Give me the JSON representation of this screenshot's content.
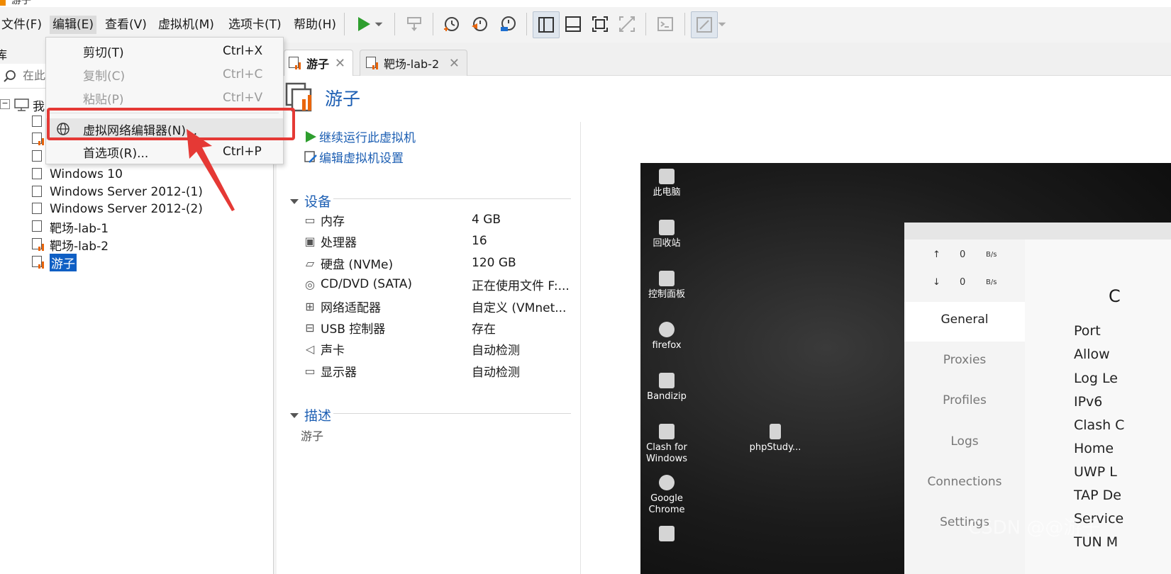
{
  "window": {
    "title": "游子"
  },
  "menubar": {
    "items": [
      "文件(F)",
      "编辑(E)",
      "查看(V)",
      "虚拟机(M)",
      "选项卡(T)",
      "帮助(H)"
    ]
  },
  "toolbar": {
    "icons": [
      "play-icon",
      "dropdown-arrow-icon",
      "send-keys-icon",
      "snapshot-icon",
      "revert-snapshot-icon",
      "snapshot-manager-icon",
      "sidebar-view-icon",
      "thumbnail-view-icon",
      "fullscreen-icon",
      "unity-icon",
      "console-icon",
      "stretch-icon"
    ]
  },
  "edit_menu": {
    "items": [
      {
        "label": "剪切(T)",
        "shortcut": "Ctrl+X",
        "enabled": true
      },
      {
        "label": "复制(C)",
        "shortcut": "Ctrl+C",
        "enabled": false
      },
      {
        "label": "粘贴(P)",
        "shortcut": "Ctrl+V",
        "enabled": false
      },
      {
        "label": "虚拟网络编辑器(N)...",
        "shortcut": "",
        "enabled": true
      },
      {
        "label": "首选项(R)...",
        "shortcut": "Ctrl+P",
        "enabled": true
      }
    ]
  },
  "library": {
    "header": "库",
    "search_placeholder": "在此处键入内容进行搜索",
    "root": "我的计算机",
    "vms": [
      "Windows 10",
      "Windows Server 2012-(1)",
      "Windows Server 2012-(2)",
      "靶场-lab-1",
      "靶场-lab-2",
      "游子"
    ],
    "selected": "游子"
  },
  "tabs": [
    {
      "label": "游子",
      "active": true
    },
    {
      "label": "靶场-lab-2",
      "active": false
    }
  ],
  "vm": {
    "name": "游子",
    "actions": [
      "继续运行此虚拟机",
      "编辑虚拟机设置"
    ],
    "devices_title": "设备",
    "devices": [
      {
        "name": "内存",
        "value": "4 GB",
        "icon": "memory-icon"
      },
      {
        "name": "处理器",
        "value": "16",
        "icon": "cpu-icon"
      },
      {
        "name": "硬盘 (NVMe)",
        "value": "120 GB",
        "icon": "disk-icon"
      },
      {
        "name": "CD/DVD (SATA)",
        "value": "正在使用文件 F:...",
        "icon": "cd-icon"
      },
      {
        "name": "网络适配器",
        "value": "自定义 (VMnet...",
        "icon": "network-icon"
      },
      {
        "name": "USB 控制器",
        "value": "存在",
        "icon": "usb-icon"
      },
      {
        "name": "声卡",
        "value": "自动检测",
        "icon": "sound-icon"
      },
      {
        "name": "显示器",
        "value": "自动检测",
        "icon": "display-icon"
      }
    ],
    "description_title": "描述",
    "description": "游子"
  },
  "preview": {
    "desktop_icons": [
      "此电脑",
      "回收站",
      "控制面板",
      "firefox",
      "Bandizip",
      "Clash for Windows",
      "Google Chrome"
    ],
    "desktop_file": "phpStudy...",
    "clash": {
      "upload_arrow": "↑",
      "download_arrow": "↓",
      "upload_value": "0",
      "download_value": "0",
      "unit": "B/s",
      "nav": [
        "General",
        "Proxies",
        "Profiles",
        "Logs",
        "Connections",
        "Settings"
      ],
      "settings_labels": [
        "Port",
        "Allow",
        "Log Le",
        "IPv6",
        "Clash C",
        "Home",
        "UWP L",
        "TAP De",
        "Service",
        "TUN M"
      ],
      "partial_title": "C"
    }
  },
  "watermark": "CSDN @@游子"
}
